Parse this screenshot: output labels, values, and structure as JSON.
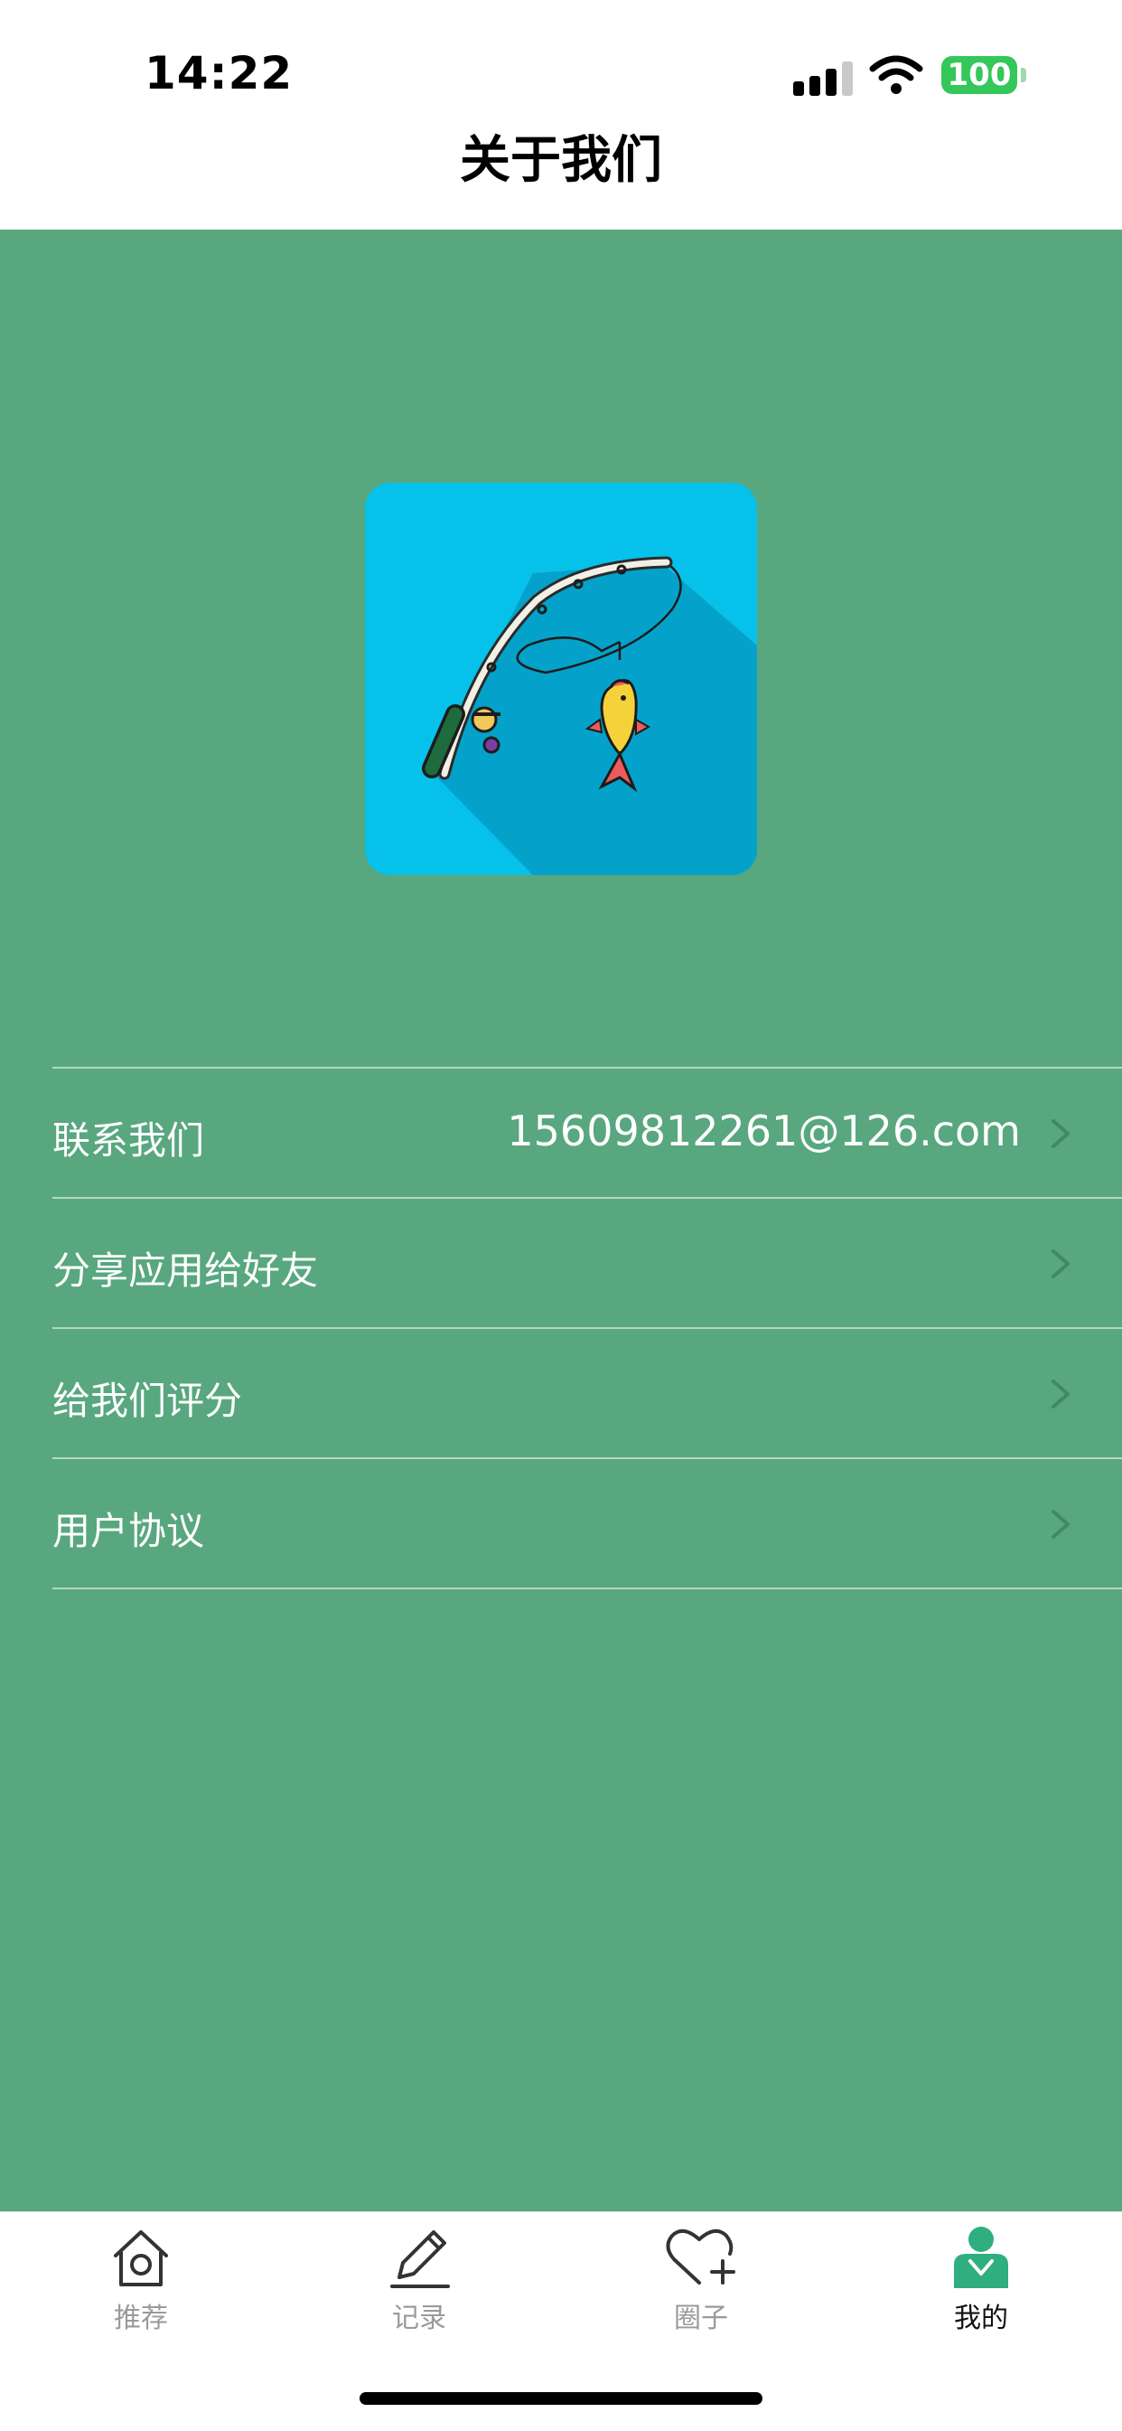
{
  "status_bar": {
    "time": "14:22",
    "battery": "100"
  },
  "nav": {
    "title": "关于我们"
  },
  "app_icon": {
    "name": "fishing-app-icon"
  },
  "menu": [
    {
      "label": "联系我们",
      "value": "15609812261@126.com"
    },
    {
      "label": "分享应用给好友",
      "value": ""
    },
    {
      "label": "给我们评分",
      "value": ""
    },
    {
      "label": "用户协议",
      "value": ""
    }
  ],
  "tabbar": [
    {
      "label": "推荐",
      "icon": "home-icon",
      "active": false
    },
    {
      "label": "记录",
      "icon": "pencil-icon",
      "active": false
    },
    {
      "label": "圈子",
      "icon": "heart-plus-icon",
      "active": false
    },
    {
      "label": "我的",
      "icon": "person-icon",
      "active": true
    }
  ],
  "colors": {
    "content_bg": "#58a77f",
    "icon_bg": "#06c2ea",
    "active_tab": "#2fae80",
    "battery": "#34c759"
  }
}
